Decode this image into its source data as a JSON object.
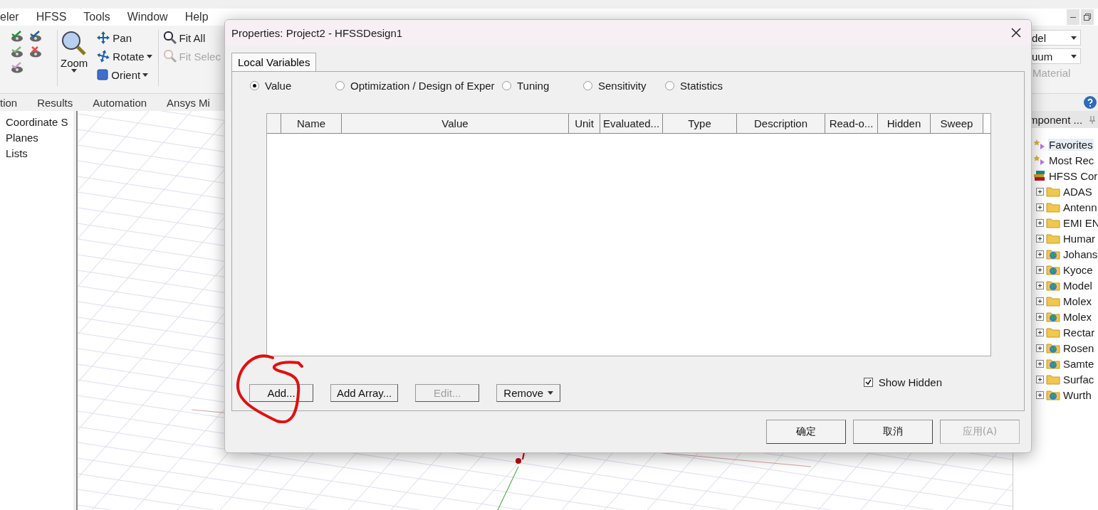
{
  "menu": [
    "eler",
    "HFSS",
    "Tools",
    "Window",
    "Help"
  ],
  "ribbon": {
    "zoom": "Zoom",
    "view_tools": [
      {
        "label": "Pan",
        "kind": "pan",
        "dropdown": false
      },
      {
        "label": "Rotate",
        "kind": "rotate",
        "dropdown": true
      },
      {
        "label": "Orient",
        "kind": "orient",
        "dropdown": true
      }
    ],
    "fit_tools": [
      {
        "label": "Fit All",
        "disabled": false
      },
      {
        "label": "Fit Selec",
        "disabled": true
      }
    ],
    "dropdowns": [
      "del",
      "uum"
    ],
    "material": "Material"
  },
  "ribbon_tabs": [
    "tion",
    "Results",
    "Automation",
    "Ansys Mi"
  ],
  "project_tree": [
    "Coordinate S",
    "Planes",
    "Lists"
  ],
  "component_panel": {
    "title": "mponent ...",
    "items": [
      {
        "label": "Favorites",
        "kind": "star",
        "expandable": false,
        "selected": true
      },
      {
        "label": "Most Rec",
        "kind": "star",
        "expandable": false,
        "selected": false
      },
      {
        "label": "HFSS Cor",
        "kind": "library",
        "expandable": false,
        "selected": false,
        "children": [
          {
            "label": "ADAS",
            "kind": "folder",
            "expandable": true,
            "selected": false
          },
          {
            "label": "Antenn",
            "kind": "folder",
            "expandable": true,
            "selected": false
          },
          {
            "label": "EMI EN",
            "kind": "folder",
            "expandable": true,
            "selected": false
          },
          {
            "label": "Humar",
            "kind": "folder",
            "expandable": true,
            "selected": false
          },
          {
            "label": "Johans",
            "kind": "web",
            "expandable": true,
            "selected": false
          },
          {
            "label": "Kyoce",
            "kind": "web",
            "expandable": true,
            "selected": false
          },
          {
            "label": "Model",
            "kind": "web",
            "expandable": true,
            "selected": false
          },
          {
            "label": "Molex",
            "kind": "folder",
            "expandable": true,
            "selected": false
          },
          {
            "label": "Molex",
            "kind": "web",
            "expandable": true,
            "selected": false
          },
          {
            "label": "Rectar",
            "kind": "folder",
            "expandable": true,
            "selected": false
          },
          {
            "label": "Rosen",
            "kind": "web",
            "expandable": true,
            "selected": false
          },
          {
            "label": "Samte",
            "kind": "web",
            "expandable": true,
            "selected": false
          },
          {
            "label": "Surfac",
            "kind": "folder",
            "expandable": true,
            "selected": false
          },
          {
            "label": "Wurth",
            "kind": "web",
            "expandable": true,
            "selected": false
          }
        ]
      }
    ]
  },
  "dialog": {
    "title": "Properties: Project2 - HFSSDesign1",
    "tabs": [
      {
        "label": "Local Variables",
        "selected": true
      }
    ],
    "modes": [
      {
        "label": "Value",
        "selected": true
      },
      {
        "label": "Optimization / Design of Exper",
        "selected": false
      },
      {
        "label": "Tuning",
        "selected": false
      },
      {
        "label": "Sensitivity",
        "selected": false
      },
      {
        "label": "Statistics",
        "selected": false
      }
    ],
    "table": {
      "columns": [
        "Name",
        "Value",
        "Unit",
        "Evaluated...",
        "Type",
        "Description",
        "Read-o...",
        "Hidden",
        "Sweep"
      ]
    },
    "show_hidden": {
      "label": "Show Hidden",
      "checked": true
    },
    "actions": [
      {
        "label": "Add...",
        "disabled": false,
        "dropdown": false,
        "circled": true
      },
      {
        "label": "Add Array...",
        "disabled": false,
        "dropdown": false,
        "circled": false
      },
      {
        "label": "Edit...",
        "disabled": true,
        "dropdown": false,
        "circled": false
      },
      {
        "label": "Remove",
        "disabled": false,
        "dropdown": true,
        "circled": false
      }
    ],
    "buttons": [
      {
        "label": "确定",
        "disabled": false
      },
      {
        "label": "取消",
        "disabled": false
      },
      {
        "label": "应用(A)",
        "disabled": true
      }
    ]
  }
}
